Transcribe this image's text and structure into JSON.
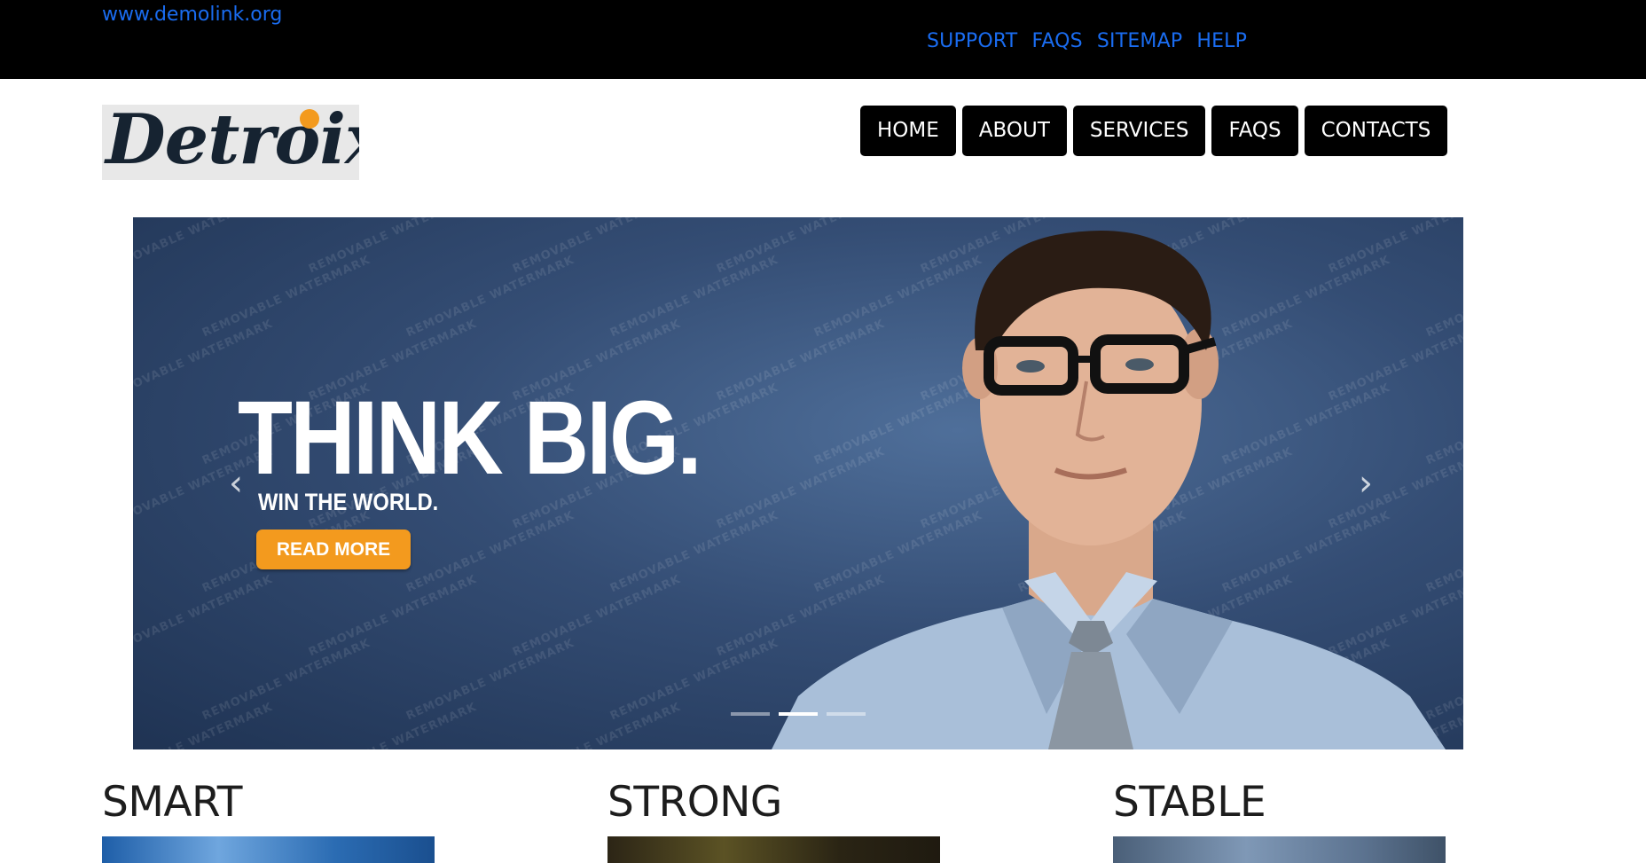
{
  "topbar": {
    "site_url": "www.demolink.org",
    "links": [
      "SUPPORT",
      "FAQS",
      "SITEMAP",
      "HELP"
    ],
    "link_color": "#1a6cf0"
  },
  "header": {
    "logo_text": "Detroix",
    "nav": [
      "HOME",
      "ABOUT",
      "SERVICES",
      "FAQS",
      "CONTACTS"
    ]
  },
  "hero": {
    "headline": "THINK BIG.",
    "subheadline": "WIN THE WORLD.",
    "button_label": "READ MORE",
    "watermark": "REMOVABLE WATERMARK",
    "prev_icon": "chevron-left-icon",
    "next_icon": "chevron-right-icon",
    "slide_count": 3,
    "active_slide": 2,
    "accent_color": "#f39a1e"
  },
  "features": [
    {
      "title": "SMART"
    },
    {
      "title": "STRONG"
    },
    {
      "title": "STABLE"
    }
  ]
}
